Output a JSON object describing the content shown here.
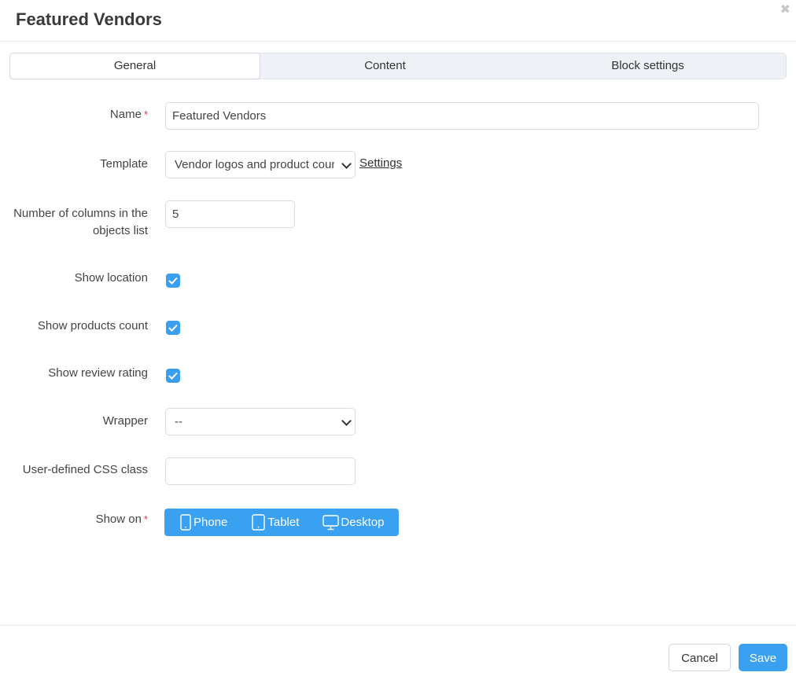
{
  "dialog": {
    "title": "Featured Vendors",
    "close_icon": "close-icon"
  },
  "tabs": [
    {
      "label": "General",
      "active": true
    },
    {
      "label": "Content",
      "active": false
    },
    {
      "label": "Block settings",
      "active": false
    }
  ],
  "form": {
    "name": {
      "label": "Name",
      "required": "*",
      "value": "Featured Vendors"
    },
    "template": {
      "label": "Template",
      "selected": "Vendor logos and product count",
      "settings_link": "Settings"
    },
    "columns": {
      "label": "Number of columns in the objects list",
      "value": "5"
    },
    "show_location": {
      "label": "Show location",
      "checked": true
    },
    "show_products_count": {
      "label": "Show products count",
      "checked": true
    },
    "show_review_rating": {
      "label": "Show review rating",
      "checked": true
    },
    "wrapper": {
      "label": "Wrapper",
      "selected": "--"
    },
    "css_class": {
      "label": "User-defined CSS class",
      "value": ""
    },
    "show_on": {
      "label": "Show on",
      "required": "*",
      "options": [
        {
          "label": "Phone",
          "icon": "phone-icon"
        },
        {
          "label": "Tablet",
          "icon": "tablet-icon"
        },
        {
          "label": "Desktop",
          "icon": "desktop-icon"
        }
      ]
    }
  },
  "footer": {
    "cancel_label": "Cancel",
    "save_label": "Save"
  },
  "colors": {
    "accent": "#3aa0f0",
    "required": "#e0393e"
  }
}
